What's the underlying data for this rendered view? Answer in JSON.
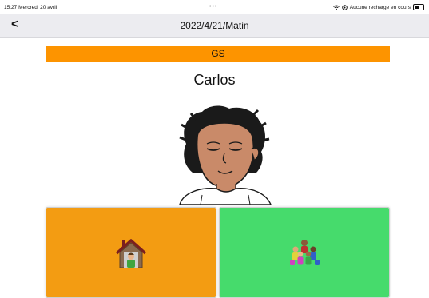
{
  "status_bar": {
    "time_date": "15:27  Mercredi 20 avril",
    "dots": "•••",
    "charging_text": "Aucune recharge en cours",
    "icons": [
      "wifi-icon",
      "location-icon",
      "battery-icon"
    ]
  },
  "nav": {
    "back_label": "<",
    "title": "2022/4/21/Matin"
  },
  "class_banner": {
    "label": "GS",
    "color": "#fd9400"
  },
  "student": {
    "name": "Carlos"
  },
  "tiles": [
    {
      "name": "home",
      "icon": "house-with-child-icon",
      "color": "#f39c12"
    },
    {
      "name": "school",
      "icon": "group-of-children-icon",
      "color": "#46db6c"
    }
  ]
}
